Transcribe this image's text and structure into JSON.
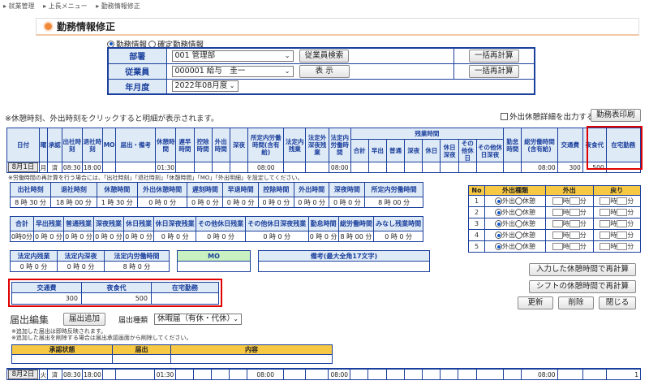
{
  "breadcrumb": [
    "▸ 就業管理",
    "▸ 上長メニュー",
    "▸ 勤務情報修正"
  ],
  "page_title": "勤務情報修正",
  "mode_options": [
    "勤務情報",
    "確定勤務情報"
  ],
  "form": {
    "dept_label": "部署",
    "dept_value": "001 管理部",
    "employee_search": "従業員検索",
    "recalc": "一括再計算",
    "employee_label": "従業員",
    "employee_value": "000001 給与　圭一",
    "show": "表 示",
    "month_label": "年月度",
    "month_value": "2022年08月度"
  },
  "note_click": "※休憩時刻、外出時刻をクリックすると明細が表示されます。",
  "out_detail_label": "外出休憩詳細を出力する",
  "print_button": "勤務表印刷",
  "main_headers": [
    "日付",
    "曜",
    "承認",
    "出社時刻",
    "退社時刻",
    "MO",
    "届出・備考",
    "休憩時間",
    "遅早時間",
    "控除時間",
    "外出時間",
    "深夜",
    "所定内労働時間(含有給)",
    "法定内残業",
    "法定外深夜残業",
    "法定内労働時間",
    "残業時間",
    "勤怠時間",
    "総労働時間(含有給)",
    "交通費",
    "夜食代",
    "在宅勤務"
  ],
  "overtime_sub": [
    "合計",
    "早出",
    "普通",
    "深夜",
    "休日",
    "休日深夜",
    "その他休日",
    "その他休日深夜"
  ],
  "day1": {
    "date": "8月1日",
    "dow": "月",
    "ok": "済",
    "in": "08:30",
    "out": "18:00",
    "rest": "01:30",
    "sched": "08:00",
    "legal": "08:00",
    "total": "08:00",
    "transport": "300",
    "meal": "500"
  },
  "day2": {
    "date": "8月2日",
    "dow": "火",
    "ok": "済",
    "in": "08:30",
    "out": "18:00",
    "rest": "01:30",
    "sched": "08:00",
    "legal": "08:00",
    "total": "08:00",
    "extra": "1"
  },
  "recalc_note": "※労働時間の再計算を行う場合には、「出社時刻」「退社時刻」「休憩時間」「MO」「外出明細」を設定してください。",
  "edit1_heads": [
    "出社時刻",
    "退社時刻",
    "休憩時間",
    "外出休憩時間",
    "遅刻時間",
    "早退時間",
    "控除時間",
    "外出時間",
    "深夜時間",
    "所定内労働時間"
  ],
  "edit1_vals": [
    "8 時 30 分",
    "18 時 00 分",
    "1 時 30 分",
    "0 時 0 分",
    "0 時 0 分",
    "0 時 0 分",
    "0 時 0 分",
    "0 時 0 分",
    "0 時 0 分",
    "8 時 00 分"
  ],
  "edit2_heads": [
    "合計",
    "早出残業",
    "普通残業",
    "深夜残業",
    "休日残業",
    "休日深夜残業",
    "その他休日残業",
    "その他休日深夜残業",
    "勤怠時間",
    "総労働時間",
    "みなし残業時間"
  ],
  "edit2_vals": [
    "0時0分",
    "0 時 0 分",
    "0 時 0 分",
    "0 時 0 分",
    "0 時 0 分",
    "0 時 0 分",
    "0 時 0 分",
    "0 時 0 分",
    "0 時 0 分",
    "8 時 00 分",
    "0 時 0 分"
  ],
  "edit3_heads": [
    "法定内残業",
    "法定内深夜",
    "法定内労働時間",
    "MO",
    "備考(最大全角17文字)"
  ],
  "edit3_vals": [
    "0 時 0 分",
    "0 時 0 分",
    "8 時 0 分"
  ],
  "edit4_heads": [
    "交通費",
    "夜食代",
    "在宅勤務"
  ],
  "edit4_vals": [
    "300",
    "500",
    ""
  ],
  "outing_heads": [
    "No",
    "外出種類",
    "外出",
    "戻り"
  ],
  "outing_rows": [
    "1",
    "2",
    "3",
    "4",
    "5"
  ],
  "outing_types": [
    "外出",
    "休憩"
  ],
  "btn_recalc_input": "入力した休憩時間で再計算",
  "btn_recalc_shift": "シフトの休憩時間で再計算",
  "btn_update": "更新",
  "btn_delete": "削除",
  "btn_close": "閉じる",
  "notice_title": "届出編集",
  "notice_add": "届出追加",
  "notice_type_label": "届出種類",
  "notice_type_value": "休暇届（有休・代休）",
  "notice_note1": "※追加した届出は即時反映されます。",
  "notice_note2": "※追加した届出を削除する場合は届出承認画面から削除してください。",
  "notice_heads": [
    "承認状態",
    "届出",
    "内容"
  ],
  "colors": {
    "accent": "#1a3f9c",
    "highlight": "#e00000",
    "yellow": "#f7c844"
  }
}
